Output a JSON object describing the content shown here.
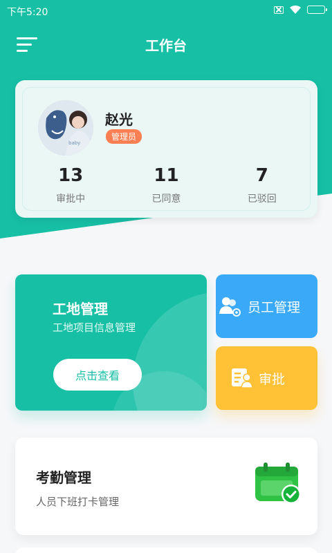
{
  "status_bar": {
    "time": "下午5:20",
    "icons": [
      "sim-off-icon",
      "wifi-icon",
      "battery-charging-icon"
    ]
  },
  "header": {
    "title": "工作台",
    "menu_icon": "hamburger-icon"
  },
  "profile": {
    "name": "赵光",
    "role": "管理员",
    "stats": [
      {
        "value": "13",
        "label": "审批中"
      },
      {
        "value": "11",
        "label": "已同意"
      },
      {
        "value": "7",
        "label": "已驳回"
      }
    ]
  },
  "site_card": {
    "title": "工地管理",
    "subtitle": "工地项目信息管理",
    "button": "点击查看"
  },
  "staff_card": {
    "label": "员工管理",
    "icon": "staff-manage-icon"
  },
  "approve_card": {
    "label": "审批",
    "icon": "approval-icon"
  },
  "attendance_card": {
    "title": "考勤管理",
    "subtitle": "人员下班打卡管理",
    "icon": "calendar-check-icon"
  },
  "colors": {
    "primary": "#17bfa5",
    "blue": "#3aa9f8",
    "yellow": "#ffc135",
    "badge": "#fb7f52",
    "calendar_green": "#2fc244"
  }
}
